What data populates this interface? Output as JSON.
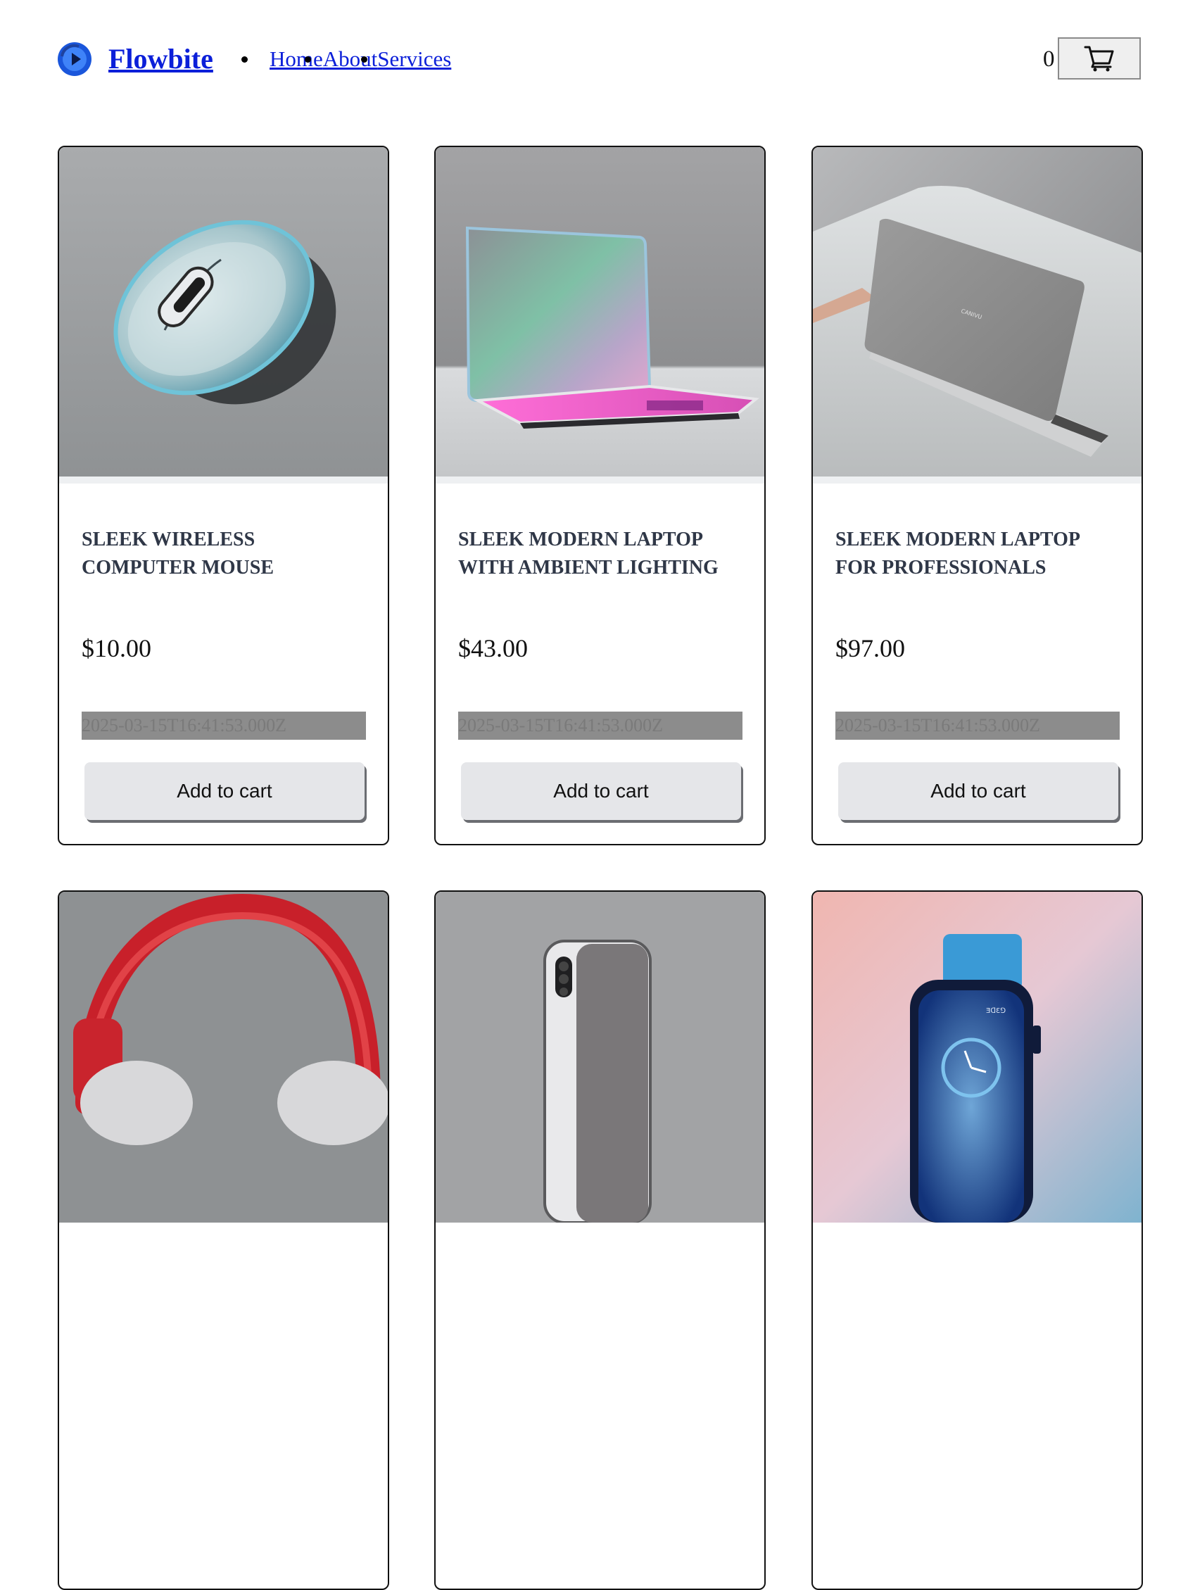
{
  "header": {
    "brand_name": "Flowbite",
    "nav": [
      "Home",
      "About",
      "Services"
    ],
    "cart_count": "0",
    "cart_icon": "shopping-cart-icon"
  },
  "products": [
    {
      "title": "Sleek Wireless Computer Mouse",
      "price": "$10.00",
      "date": "2025-03-15T16:41:53.000Z",
      "button": "Add to cart",
      "image": "wireless-mouse-image"
    },
    {
      "title": "Sleek Modern Laptop with Ambient Lighting",
      "price": "$43.00",
      "date": "2025-03-15T16:41:53.000Z",
      "button": "Add to cart",
      "image": "laptop-ambient-lighting-image"
    },
    {
      "title": "Sleek Modern Laptop for Professionals",
      "price": "$97.00",
      "date": "2025-03-15T16:41:53.000Z",
      "button": "Add to cart",
      "image": "laptop-professional-image"
    },
    {
      "image": "red-headphones-image"
    },
    {
      "image": "smartphone-image"
    },
    {
      "image": "smartwatch-image"
    }
  ],
  "colors": {
    "link": "#0b1fd9",
    "title": "#2f3747",
    "button_bg": "#e5e6e9",
    "date_bg": "#8c8c8c"
  }
}
